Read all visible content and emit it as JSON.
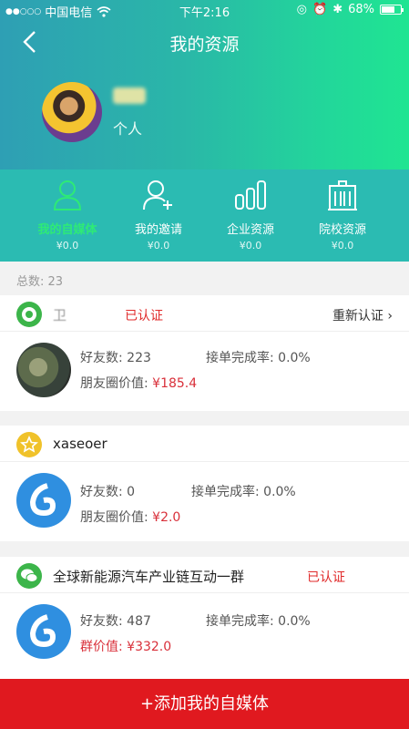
{
  "status_bar": {
    "carrier": "中国电信",
    "time": "下午2:16",
    "battery": "68%"
  },
  "header": {
    "title": "我的资源",
    "user_type": "个人"
  },
  "tabs": [
    {
      "label": "我的自媒体",
      "value": "¥0.0",
      "icon": "person-icon",
      "active": true
    },
    {
      "label": "我的邀请",
      "value": "¥0.0",
      "icon": "person-add-icon",
      "active": false
    },
    {
      "label": "企业资源",
      "value": "¥0.0",
      "icon": "bar-chart-icon",
      "active": false
    },
    {
      "label": "院校资源",
      "value": "¥0.0",
      "icon": "building-icon",
      "active": false
    }
  ],
  "total_label": "总数: 23",
  "resources": [
    {
      "name": "卫",
      "platform_icon": "camera-lens-icon",
      "verified_label": "已认证",
      "reverify_label": "重新认证",
      "friends": "好友数: 223",
      "completion": "接单完成率: 0.0%",
      "value_label": "朋友圈价值: ",
      "value": "¥185.4"
    },
    {
      "name": "xaseoer",
      "platform_icon": "star-icon",
      "friends": "好友数: 0",
      "completion": "接单完成率: 0.0%",
      "value_label": "朋友圈价值: ",
      "value": "¥2.0"
    },
    {
      "name": "全球新能源汽车产业链互动一群",
      "platform_icon": "wechat-icon",
      "verified_label": "已认证",
      "friends": "好友数: 487",
      "completion": "接单完成率: 0.0%",
      "value_label": "群价值: ",
      "value": "¥332.0"
    }
  ],
  "add_button": "+添加我的自媒体",
  "colors": {
    "accent_green": "#2eea76",
    "header_teal": "#2bbbb2",
    "money_red": "#d9303a",
    "button_red": "#e0191f"
  }
}
